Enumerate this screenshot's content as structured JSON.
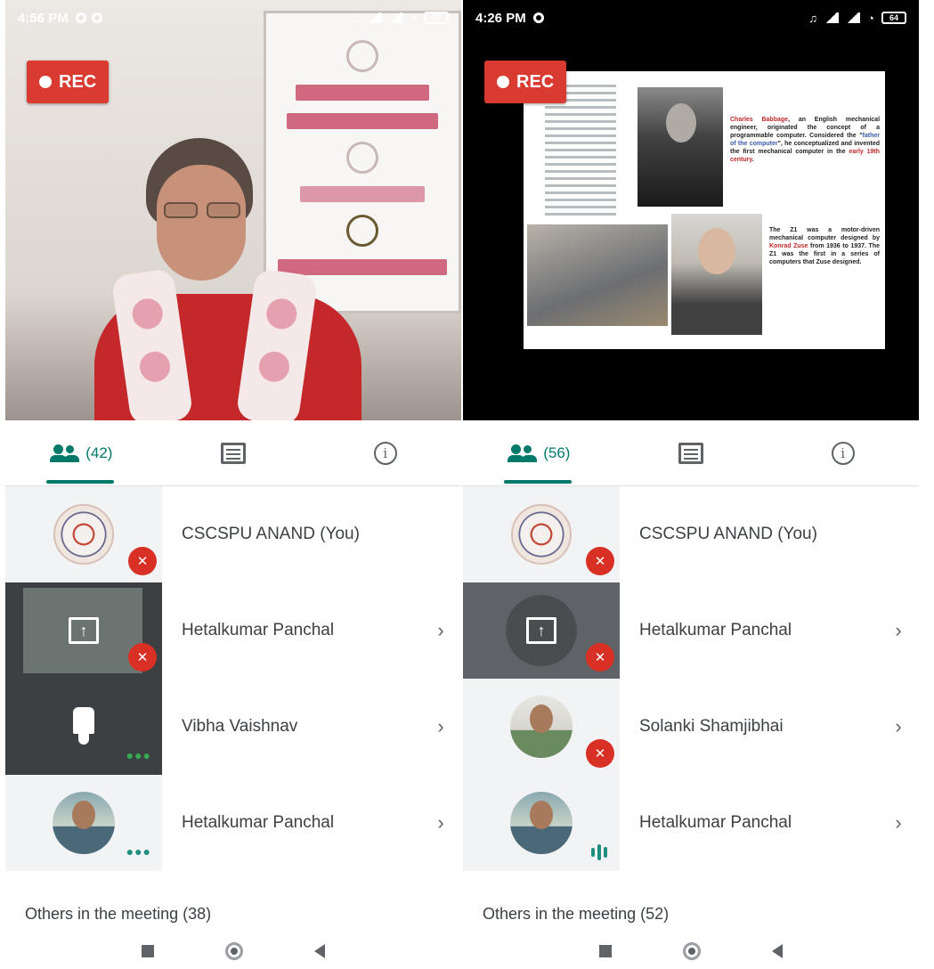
{
  "left": {
    "status_time": "4:56 PM",
    "battery": "67",
    "rec_label": "REC",
    "people_count": "(42)",
    "participants": [
      {
        "name": "CSCSPU ANAND (You)",
        "status": "muted"
      },
      {
        "name": "Hetalkumar Panchal",
        "status": "muted"
      },
      {
        "name": "Vibha Vaishnav",
        "status": "dots"
      },
      {
        "name": "Hetalkumar Panchal",
        "status": "dots"
      }
    ],
    "others_label": "Others in the meeting (38)"
  },
  "right": {
    "status_time": "4:26 PM",
    "battery": "64",
    "rec_label": "REC",
    "people_count": "(56)",
    "slide": {
      "text1_name": "Charles Babbage",
      "text1_a": ", an English mechanical engineer, originated the concept of a programmable computer. Considered the \"",
      "text1_link": "father of the computer",
      "text1_b": "\", he conceptualized and invented the first mechanical computer in the ",
      "text1_century": "early 19th century",
      "text1_end": ".",
      "text2_a": "The Z1 was a motor-driven mechanical computer designed by ",
      "text2_name": "Konrad Zuse",
      "text2_b": " from 1936 to 1937. The Z1 was the first in a series of computers that Zuse designed."
    },
    "participants": [
      {
        "name": "CSCSPU ANAND (You)",
        "status": "muted"
      },
      {
        "name": "Hetalkumar Panchal",
        "status": "muted"
      },
      {
        "name": "Solanki Shamjibhai",
        "status": "muted"
      },
      {
        "name": "Hetalkumar Panchal",
        "status": "speaking"
      }
    ],
    "others_label": "Others in the meeting (52)"
  },
  "icons": {
    "tab_people": "people-icon",
    "tab_chat": "chat-icon",
    "tab_info": "info-icon",
    "mute": "mic-off-icon",
    "chevron": "chevron-right-icon"
  },
  "colors": {
    "accent": "#00796b",
    "rec": "#d93b30",
    "mute": "#d93025"
  }
}
